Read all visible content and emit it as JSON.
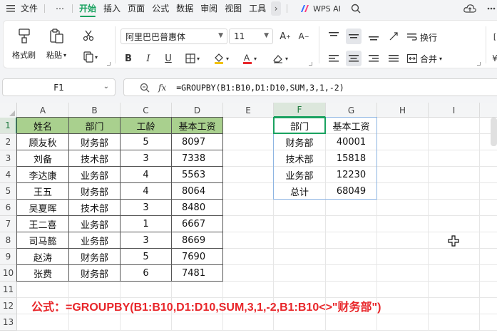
{
  "menubar": {
    "file": "文件",
    "more": "⋯",
    "tabs": [
      "开始",
      "插入",
      "页面",
      "公式",
      "数据",
      "审阅",
      "视图",
      "工具"
    ],
    "active_tab": "开始",
    "wps_ai": "WPS AI"
  },
  "ribbon": {
    "format_painter": "格式刷",
    "paste": "粘贴",
    "font_name": "阿里巴巴普惠体",
    "font_size": "11",
    "wrap_text": "换行",
    "merge": "合并"
  },
  "formula_bar": {
    "name_box": "F1",
    "fx": "fx",
    "formula": "=GROUPBY(B1:B10,D1:D10,SUM,3,1,-2)"
  },
  "grid": {
    "columns": [
      "A",
      "B",
      "C",
      "D",
      "E",
      "F",
      "G",
      "H",
      "I"
    ],
    "rows": [
      "1",
      "2",
      "3",
      "4",
      "5",
      "6",
      "7",
      "8",
      "9",
      "10",
      "11",
      "12",
      "13"
    ],
    "active_column": "F",
    "active_row": "1"
  },
  "source_table": {
    "headers": [
      "姓名",
      "部门",
      "工龄",
      "基本工资"
    ],
    "rows": [
      [
        "顾友秋",
        "财务部",
        "5",
        "8097"
      ],
      [
        "刘备",
        "技术部",
        "3",
        "7338"
      ],
      [
        "李达康",
        "业务部",
        "4",
        "5563"
      ],
      [
        "王五",
        "财务部",
        "4",
        "8064"
      ],
      [
        "吴夏晖",
        "技术部",
        "3",
        "8480"
      ],
      [
        "王二喜",
        "业务部",
        "1",
        "6667"
      ],
      [
        "司马懿",
        "业务部",
        "3",
        "8669"
      ],
      [
        "赵涛",
        "财务部",
        "5",
        "7690"
      ],
      [
        "张费",
        "财务部",
        "6",
        "7481"
      ]
    ]
  },
  "result_table": {
    "headers": [
      "部门",
      "基本工资"
    ],
    "rows": [
      [
        "财务部",
        "40001"
      ],
      [
        "技术部",
        "15818"
      ],
      [
        "业务部",
        "12230"
      ],
      [
        "总计",
        "68049"
      ]
    ]
  },
  "note": "公式：=GROUPBY(B1:B10,D1:D10,SUM,3,1,-2,B1:B10<>\"财务部\")",
  "colors": {
    "accent": "#1aa260",
    "header_fill": "#a9d08e",
    "note": "#e8262a",
    "result_border": "#8db4e2"
  }
}
